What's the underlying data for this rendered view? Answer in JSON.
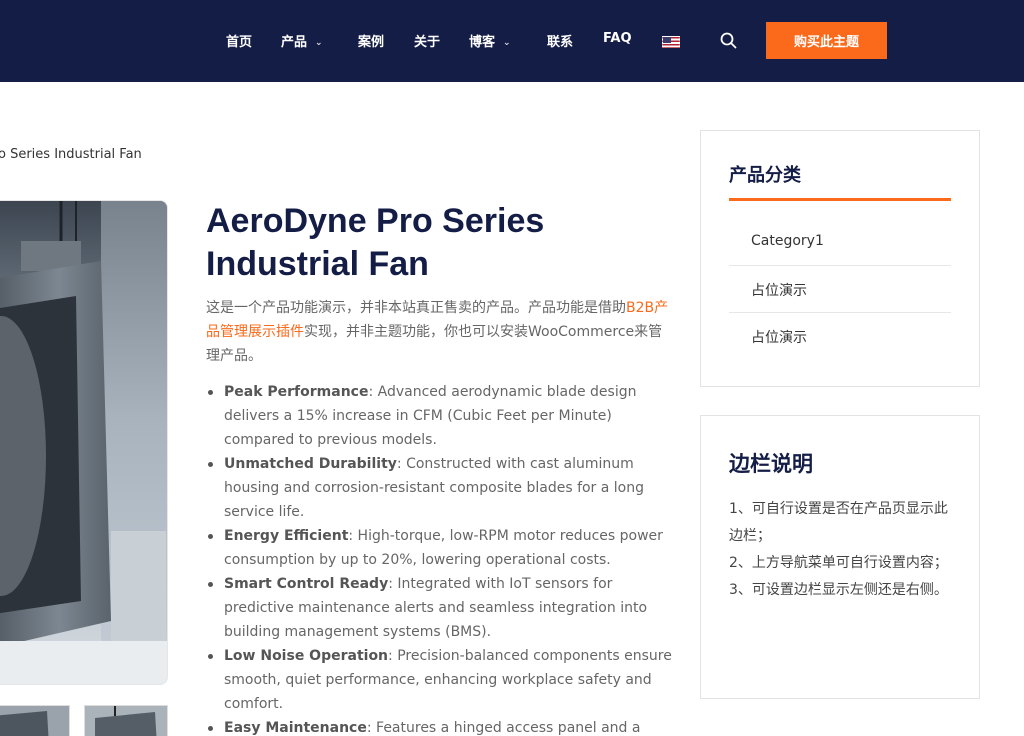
{
  "header": {
    "nav": [
      {
        "label": "首页"
      },
      {
        "label": "产品"
      },
      {
        "label": "案例"
      },
      {
        "label": "关于"
      },
      {
        "label": "博客"
      },
      {
        "label": "联系"
      },
      {
        "label": "FAQ"
      }
    ],
    "buy_button": "购买此主题",
    "icons": {
      "search": "search-icon",
      "flag": "us-flag-icon",
      "dropdown": "chevron-down-icon"
    }
  },
  "breadcrumb": "o Series Industrial Fan",
  "product": {
    "title_line1": "AeroDyne Pro Series",
    "title_line2": "Industrial Fan",
    "intro_pre": "这是一个产品功能演示，并非本站真正售卖的产品。产品功能是借助",
    "intro_link": "B2B产品管理展示插件",
    "intro_post": "实现，并非主题功能，你也可以安装WooCommerce来管理产品。",
    "features": [
      {
        "name": "Peak Performance",
        "text": ": Advanced aerodynamic blade design delivers a 15% increase in CFM (Cubic Feet per Minute) compared to previous models."
      },
      {
        "name": "Unmatched Durability",
        "text": ": Constructed with cast aluminum housing and corrosion-resistant composite blades for a long service life."
      },
      {
        "name": "Energy Efficient",
        "text": ": High-torque, low-RPM motor reduces power consumption by up to 20%, lowering operational costs."
      },
      {
        "name": "Smart Control Ready",
        "text": ": Integrated with IoT sensors for predictive maintenance alerts and seamless integration into building management systems (BMS)."
      },
      {
        "name": "Low Noise Operation",
        "text": ": Precision-balanced components ensure smooth, quiet performance, enhancing workplace safety and comfort."
      },
      {
        "name": "Easy Maintenance",
        "text": ": Features a hinged access panel and a tool-"
      }
    ]
  },
  "sidebar": {
    "categories_title": "产品分类",
    "categories": [
      {
        "label": "Category1"
      },
      {
        "label": "占位演示"
      },
      {
        "label": "占位演示"
      }
    ],
    "notes_title": "边栏说明",
    "notes": [
      "1、可自行设置是否在产品页显示此边栏；",
      "2、上方导航菜单可自行设置内容；",
      "3、可设置边栏显示左侧还是右侧。"
    ]
  },
  "colors": {
    "header_bg": "#141d45",
    "accent": "#fb6a1a",
    "title": "#141d45"
  }
}
